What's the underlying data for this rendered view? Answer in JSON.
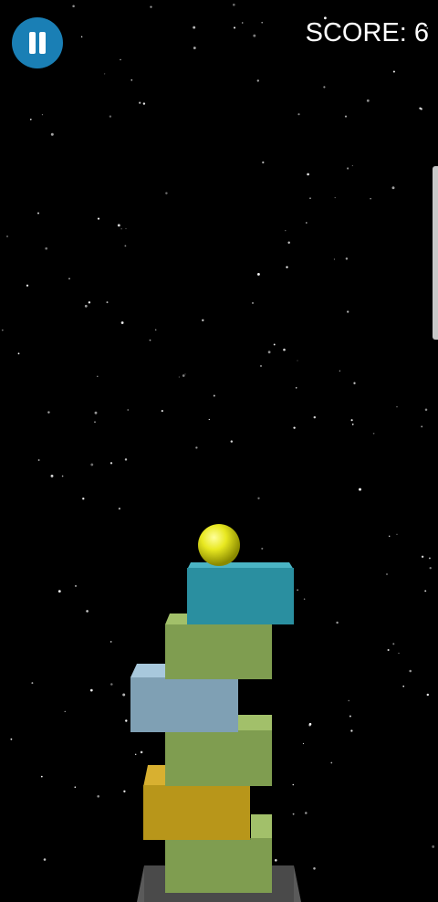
{
  "hud": {
    "pause_icon": "pause-icon",
    "score_text": "SCORE: 6"
  },
  "scene": {
    "ball_color": "#e8e820",
    "blocks": [
      {
        "name": "block-teal-top",
        "color": "#2a8fa0"
      },
      {
        "name": "block-green-2",
        "color": "#7f9d50"
      },
      {
        "name": "block-blue-grey",
        "color": "#7fa0b4"
      },
      {
        "name": "block-green-4",
        "color": "#7f9d50"
      },
      {
        "name": "block-mustard",
        "color": "#b8961a"
      },
      {
        "name": "block-green-bottom",
        "color": "#7f9d50"
      }
    ],
    "base_color": "#4a4a4a"
  }
}
